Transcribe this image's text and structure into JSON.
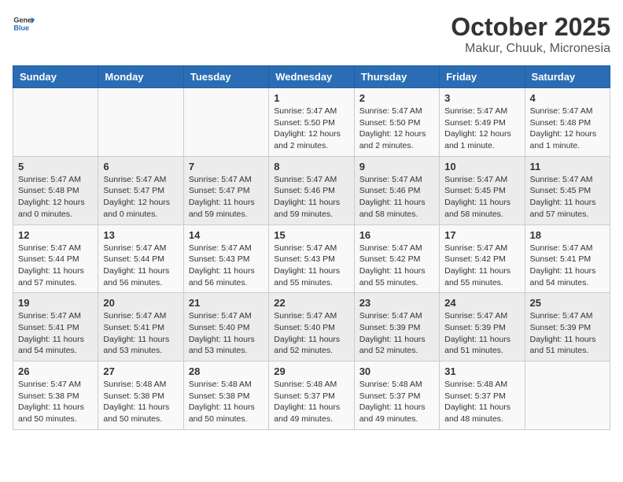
{
  "header": {
    "logo_general": "General",
    "logo_blue": "Blue",
    "month": "October 2025",
    "location": "Makur, Chuuk, Micronesia"
  },
  "weekdays": [
    "Sunday",
    "Monday",
    "Tuesday",
    "Wednesday",
    "Thursday",
    "Friday",
    "Saturday"
  ],
  "weeks": [
    [
      {
        "day": "",
        "info": ""
      },
      {
        "day": "",
        "info": ""
      },
      {
        "day": "",
        "info": ""
      },
      {
        "day": "1",
        "info": "Sunrise: 5:47 AM\nSunset: 5:50 PM\nDaylight: 12 hours and 2 minutes."
      },
      {
        "day": "2",
        "info": "Sunrise: 5:47 AM\nSunset: 5:50 PM\nDaylight: 12 hours and 2 minutes."
      },
      {
        "day": "3",
        "info": "Sunrise: 5:47 AM\nSunset: 5:49 PM\nDaylight: 12 hours and 1 minute."
      },
      {
        "day": "4",
        "info": "Sunrise: 5:47 AM\nSunset: 5:48 PM\nDaylight: 12 hours and 1 minute."
      }
    ],
    [
      {
        "day": "5",
        "info": "Sunrise: 5:47 AM\nSunset: 5:48 PM\nDaylight: 12 hours and 0 minutes."
      },
      {
        "day": "6",
        "info": "Sunrise: 5:47 AM\nSunset: 5:47 PM\nDaylight: 12 hours and 0 minutes."
      },
      {
        "day": "7",
        "info": "Sunrise: 5:47 AM\nSunset: 5:47 PM\nDaylight: 11 hours and 59 minutes."
      },
      {
        "day": "8",
        "info": "Sunrise: 5:47 AM\nSunset: 5:46 PM\nDaylight: 11 hours and 59 minutes."
      },
      {
        "day": "9",
        "info": "Sunrise: 5:47 AM\nSunset: 5:46 PM\nDaylight: 11 hours and 58 minutes."
      },
      {
        "day": "10",
        "info": "Sunrise: 5:47 AM\nSunset: 5:45 PM\nDaylight: 11 hours and 58 minutes."
      },
      {
        "day": "11",
        "info": "Sunrise: 5:47 AM\nSunset: 5:45 PM\nDaylight: 11 hours and 57 minutes."
      }
    ],
    [
      {
        "day": "12",
        "info": "Sunrise: 5:47 AM\nSunset: 5:44 PM\nDaylight: 11 hours and 57 minutes."
      },
      {
        "day": "13",
        "info": "Sunrise: 5:47 AM\nSunset: 5:44 PM\nDaylight: 11 hours and 56 minutes."
      },
      {
        "day": "14",
        "info": "Sunrise: 5:47 AM\nSunset: 5:43 PM\nDaylight: 11 hours and 56 minutes."
      },
      {
        "day": "15",
        "info": "Sunrise: 5:47 AM\nSunset: 5:43 PM\nDaylight: 11 hours and 55 minutes."
      },
      {
        "day": "16",
        "info": "Sunrise: 5:47 AM\nSunset: 5:42 PM\nDaylight: 11 hours and 55 minutes."
      },
      {
        "day": "17",
        "info": "Sunrise: 5:47 AM\nSunset: 5:42 PM\nDaylight: 11 hours and 55 minutes."
      },
      {
        "day": "18",
        "info": "Sunrise: 5:47 AM\nSunset: 5:41 PM\nDaylight: 11 hours and 54 minutes."
      }
    ],
    [
      {
        "day": "19",
        "info": "Sunrise: 5:47 AM\nSunset: 5:41 PM\nDaylight: 11 hours and 54 minutes."
      },
      {
        "day": "20",
        "info": "Sunrise: 5:47 AM\nSunset: 5:41 PM\nDaylight: 11 hours and 53 minutes."
      },
      {
        "day": "21",
        "info": "Sunrise: 5:47 AM\nSunset: 5:40 PM\nDaylight: 11 hours and 53 minutes."
      },
      {
        "day": "22",
        "info": "Sunrise: 5:47 AM\nSunset: 5:40 PM\nDaylight: 11 hours and 52 minutes."
      },
      {
        "day": "23",
        "info": "Sunrise: 5:47 AM\nSunset: 5:39 PM\nDaylight: 11 hours and 52 minutes."
      },
      {
        "day": "24",
        "info": "Sunrise: 5:47 AM\nSunset: 5:39 PM\nDaylight: 11 hours and 51 minutes."
      },
      {
        "day": "25",
        "info": "Sunrise: 5:47 AM\nSunset: 5:39 PM\nDaylight: 11 hours and 51 minutes."
      }
    ],
    [
      {
        "day": "26",
        "info": "Sunrise: 5:47 AM\nSunset: 5:38 PM\nDaylight: 11 hours and 50 minutes."
      },
      {
        "day": "27",
        "info": "Sunrise: 5:48 AM\nSunset: 5:38 PM\nDaylight: 11 hours and 50 minutes."
      },
      {
        "day": "28",
        "info": "Sunrise: 5:48 AM\nSunset: 5:38 PM\nDaylight: 11 hours and 50 minutes."
      },
      {
        "day": "29",
        "info": "Sunrise: 5:48 AM\nSunset: 5:37 PM\nDaylight: 11 hours and 49 minutes."
      },
      {
        "day": "30",
        "info": "Sunrise: 5:48 AM\nSunset: 5:37 PM\nDaylight: 11 hours and 49 minutes."
      },
      {
        "day": "31",
        "info": "Sunrise: 5:48 AM\nSunset: 5:37 PM\nDaylight: 11 hours and 48 minutes."
      },
      {
        "day": "",
        "info": ""
      }
    ]
  ]
}
